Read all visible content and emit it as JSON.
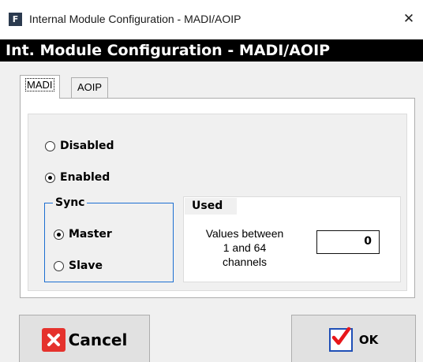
{
  "window": {
    "app_icon_letter": "F",
    "title": "Internal Module Configuration - MADI/AOIP",
    "close_glyph": "✕"
  },
  "header": {
    "title": "Int. Module Configuration - MADI/AOIP"
  },
  "tabs": [
    {
      "label": "MADI",
      "active": true
    },
    {
      "label": "AOIP",
      "active": false
    }
  ],
  "madi": {
    "state_options": [
      {
        "label": "Disabled",
        "checked": false
      },
      {
        "label": "Enabled",
        "checked": true
      }
    ],
    "sync": {
      "title": "Sync",
      "options": [
        {
          "label": "Master",
          "checked": true
        },
        {
          "label": "Slave",
          "checked": false
        }
      ]
    },
    "used": {
      "title": "Used",
      "description_lines": [
        "Values between",
        "1 and 64",
        "channels"
      ],
      "value": "0"
    }
  },
  "buttons": {
    "cancel": {
      "label": "Cancel",
      "icon": "cancel-x-icon"
    },
    "ok": {
      "label": "OK",
      "icon": "checkmark-icon"
    }
  },
  "colors": {
    "header_bg": "#000000",
    "sync_border": "#1c6fd1",
    "cancel_icon": "#e5322d",
    "ok_check": "#e8161a",
    "ok_box_border": "#1f4fb6"
  }
}
